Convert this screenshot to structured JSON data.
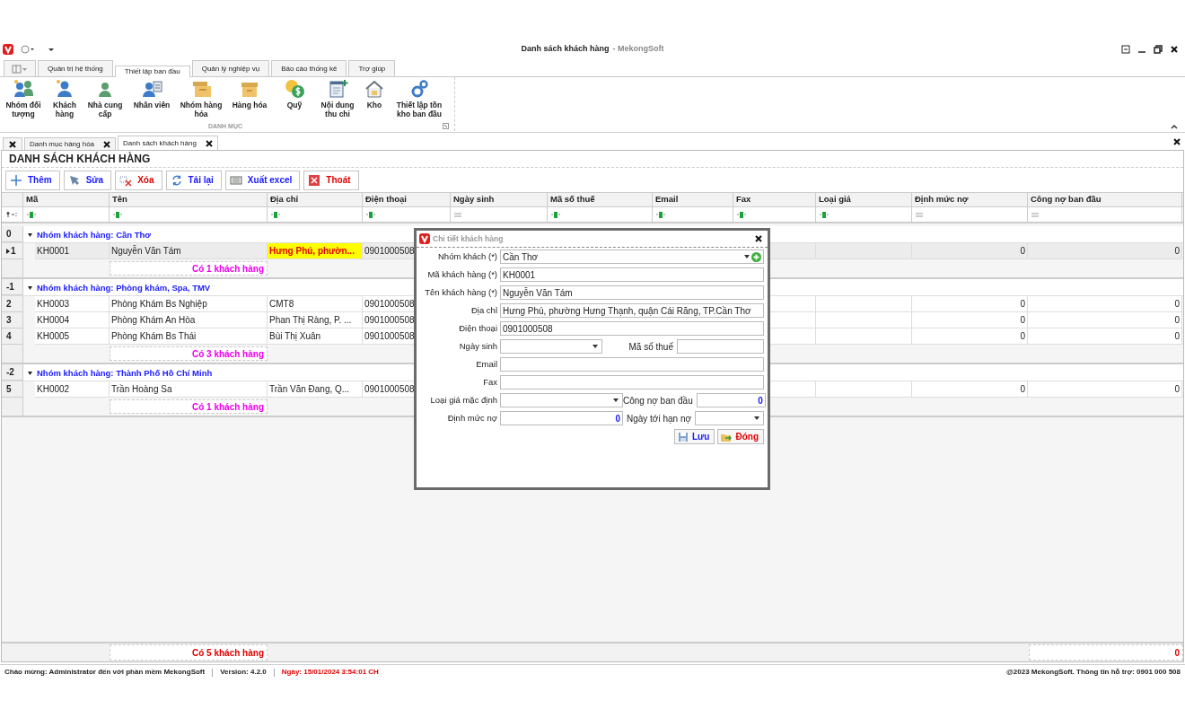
{
  "window": {
    "title": "Danh sách khách hàng",
    "subtitle": "- MekongSoft"
  },
  "ribbon": {
    "tabs": [
      {
        "label": "Quản trị hệ thống",
        "selected": false
      },
      {
        "label": "Thiết lập ban đầu",
        "selected": true
      },
      {
        "label": "Quản lý nghiệp vụ",
        "selected": false
      },
      {
        "label": "Báo cáo thống kê",
        "selected": false
      },
      {
        "label": "Trợ giúp",
        "selected": false
      }
    ],
    "buttons": [
      {
        "label": "Nhóm đối tượng",
        "kind": "group"
      },
      {
        "label": "Khách hàng",
        "kind": "customer"
      },
      {
        "label": "Nhà cung cấp",
        "kind": "supplier"
      },
      {
        "label": "Nhân viên",
        "kind": "staff"
      },
      {
        "label": "Nhóm hàng hóa",
        "kind": "product_group"
      },
      {
        "label": "Hàng hóa",
        "kind": "product"
      },
      {
        "label": "Quỹ",
        "kind": "fund"
      },
      {
        "label": "Nội dung thu chi",
        "kind": "cashbook"
      },
      {
        "label": "Kho",
        "kind": "warehouse"
      },
      {
        "label": "Thiết lập tồn kho ban đầu",
        "kind": "stock"
      }
    ],
    "group_label": "DANH MỤC"
  },
  "document_tabs": [
    {
      "label": "Danh mục hàng hóa",
      "selected": false
    },
    {
      "label": "Danh sách khách hàng",
      "selected": true
    }
  ],
  "page_title": "DANH SÁCH KHÁCH HÀNG",
  "toolbar": [
    {
      "label": "Thêm",
      "kind": "add",
      "color": "#1a1aff"
    },
    {
      "label": "Sửa",
      "kind": "edit",
      "color": "#1a1aff"
    },
    {
      "label": "Xóa",
      "kind": "delete",
      "color": "#e00000"
    },
    {
      "label": "Tải lại",
      "kind": "reload",
      "color": "#1a1aff"
    },
    {
      "label": "Xuất excel",
      "kind": "excel",
      "color": "#1a1aff"
    },
    {
      "label": "Thoát",
      "kind": "exit",
      "color": "#e00000"
    }
  ],
  "grid": {
    "columns": [
      {
        "label": "Mã",
        "kind": "text"
      },
      {
        "label": "Tên",
        "kind": "text"
      },
      {
        "label": "Địa chỉ",
        "kind": "text"
      },
      {
        "label": "Điện thoại",
        "kind": "text"
      },
      {
        "label": "Ngày sinh",
        "kind": "numeric"
      },
      {
        "label": "Mã số thuế",
        "kind": "text"
      },
      {
        "label": "Email",
        "kind": "text"
      },
      {
        "label": "Fax",
        "kind": "text"
      },
      {
        "label": "Loại giá",
        "kind": "text"
      },
      {
        "label": "Định mức nợ",
        "kind": "numeric"
      },
      {
        "label": "Công nợ ban đầu",
        "kind": "numeric"
      }
    ],
    "groups": [
      {
        "indicator": "0",
        "title": "Nhóm khách hàng: Cần Thơ",
        "expanded": true,
        "summary": "Có 1 khách hàng",
        "rows": [
          {
            "indicator": "1",
            "selected": true,
            "ma": "KH0001",
            "ten": "Nguyễn Văn Tám",
            "dia_chi": "Hưng Phú, phườn...",
            "dien_thoai": "0901000508",
            "dinh_muc_no": "0",
            "cong_no_ban_dau": "0"
          }
        ]
      },
      {
        "indicator": "-1",
        "title": "Nhóm khách hàng: Phòng khám, Spa, TMV",
        "expanded": true,
        "summary": "Có 3 khách hàng",
        "rows": [
          {
            "indicator": "2",
            "selected": false,
            "ma": "KH0003",
            "ten": "Phòng Khám Bs Nghiệp",
            "dia_chi": "CMT8",
            "dien_thoai": "0901000508",
            "dinh_muc_no": "0",
            "cong_no_ban_dau": "0"
          },
          {
            "indicator": "3",
            "selected": false,
            "ma": "KH0004",
            "ten": "Phòng Khám An Hòa",
            "dia_chi": "Phan Thị Ràng, P. ...",
            "dien_thoai": "0901000508",
            "dinh_muc_no": "0",
            "cong_no_ban_dau": "0"
          },
          {
            "indicator": "4",
            "selected": false,
            "ma": "KH0005",
            "ten": "Phòng Khám Bs Thái",
            "dia_chi": "Bùi Thị Xuân",
            "dien_thoai": "0901000508",
            "dinh_muc_no": "0",
            "cong_no_ban_dau": "0"
          }
        ]
      },
      {
        "indicator": "-2",
        "title": "Nhóm khách hàng: Thành Phố Hồ Chí Minh",
        "expanded": true,
        "summary": "Có 1 khách hàng",
        "rows": [
          {
            "indicator": "5",
            "selected": false,
            "ma": "KH0002",
            "ten": "Trần Hoàng Sa",
            "dia_chi": "Trần Văn Đang, Q...",
            "dien_thoai": "0901000508",
            "dinh_muc_no": "0",
            "cong_no_ban_dau": "0"
          }
        ]
      }
    ],
    "footer": {
      "count": "Có 5 khách hàng",
      "total": "0"
    }
  },
  "dialog": {
    "title": "Chi tiết khách hàng",
    "rows": [
      {
        "fields": [
          {
            "label": "Nhóm khách (*)",
            "value": "Cần Thơ",
            "kind": "combo_add"
          }
        ]
      },
      {
        "fields": [
          {
            "label": "Mã khách hàng (*)",
            "value": "KH0001",
            "kind": "text"
          }
        ]
      },
      {
        "fields": [
          {
            "label": "Tên khách hàng (*)",
            "value": "Nguyễn Văn Tám",
            "kind": "text"
          }
        ]
      },
      {
        "fields": [
          {
            "label": "Địa chỉ",
            "value": "Hưng Phú, phường Hưng Thạnh, quận Cái Răng, TP.Cần Thơ",
            "kind": "text"
          }
        ]
      },
      {
        "fields": [
          {
            "label": "Điện thoại",
            "value": "0901000508",
            "kind": "text"
          }
        ]
      },
      {
        "fields": [
          {
            "label": "Ngày sinh",
            "kind": "date"
          },
          {
            "label": "Mã số thuế",
            "kind": "text"
          }
        ]
      },
      {
        "fields": [
          {
            "label": "Email",
            "kind": "text"
          }
        ]
      },
      {
        "fields": [
          {
            "label": "Fax",
            "kind": "text"
          }
        ]
      },
      {
        "fields": [
          {
            "label": "Loại giá mặc định",
            "kind": "combo"
          },
          {
            "label": "Công nợ ban đầu",
            "value": "0",
            "kind": "number"
          }
        ]
      },
      {
        "fields": [
          {
            "label": "Định mức nợ",
            "value": "0",
            "kind": "number"
          },
          {
            "label": "Ngày tới hạn nợ",
            "kind": "date"
          }
        ]
      }
    ],
    "buttons": [
      {
        "label": "Lưu",
        "kind": "save",
        "color": "#1a1aff"
      },
      {
        "label": "Đóng",
        "kind": "close",
        "color": "#e00000"
      }
    ]
  },
  "status_bar": {
    "welcome": "Chào mừng: Administrator đến với phần mềm MekongSoft",
    "version": "Version: 4.2.0",
    "date": "Ngày: 15/01/2024 3:54:01 CH",
    "copyright": "@2023 MekongSoft. Thông tin hỗ trợ: 0901 000 508"
  }
}
